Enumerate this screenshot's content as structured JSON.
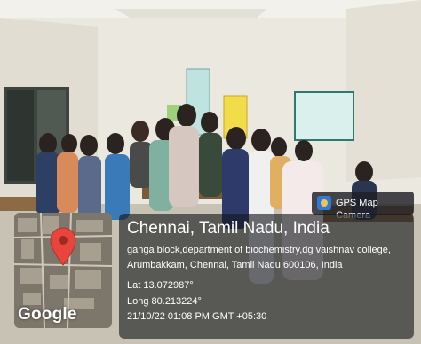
{
  "stamp": {
    "app_name": "GPS Map Camera",
    "place": "Chennai, Tamil Nadu, India",
    "address": "ganga block,department of biochemistry,dg vaishnav college, Arumbakkam, Chennai, Tamil Nadu 600106, India",
    "lat": "Lat 13.072987°",
    "long": "Long 80.213224°",
    "datetime": "21/10/22 01:08 PM GMT +05:30",
    "map_brand": "Google"
  },
  "colors": {
    "wall": "#ece9e1",
    "overlay": "#14161c",
    "pin": "#e8453c",
    "board_blue": "#bfe3df",
    "board_yellow": "#f2dc4a"
  }
}
